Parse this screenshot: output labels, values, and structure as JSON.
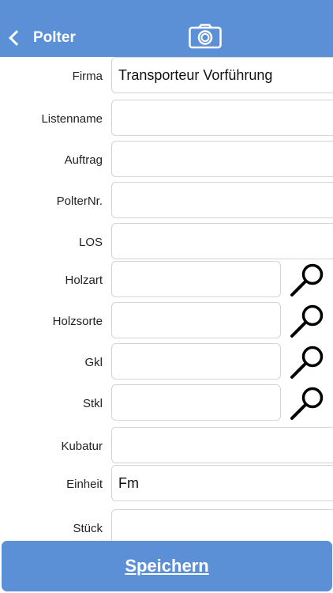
{
  "header": {
    "back_label": "Polter",
    "camera_icon": "camera-icon"
  },
  "colors": {
    "accent": "#5b8fd6",
    "field_border": "#d4d4d4"
  },
  "form": {
    "firma": {
      "label": "Firma",
      "value": "Transporteur Vorführung"
    },
    "listenname": {
      "label": "Listenname",
      "value": ""
    },
    "auftrag": {
      "label": "Auftrag",
      "value": ""
    },
    "polternr": {
      "label": "PolterNr.",
      "value": ""
    },
    "los": {
      "label": "LOS",
      "value": ""
    },
    "holzart": {
      "label": "Holzart",
      "value": ""
    },
    "holzsorte": {
      "label": "Holzsorte",
      "value": ""
    },
    "gkl": {
      "label": "Gkl",
      "value": ""
    },
    "stkl": {
      "label": "Stkl",
      "value": ""
    },
    "kubatur": {
      "label": "Kubatur",
      "value": ""
    },
    "einheit": {
      "label": "Einheit",
      "value": "Fm"
    },
    "stueck": {
      "label": "Stück",
      "value": ""
    }
  },
  "footer": {
    "save_label": "Speichern"
  }
}
